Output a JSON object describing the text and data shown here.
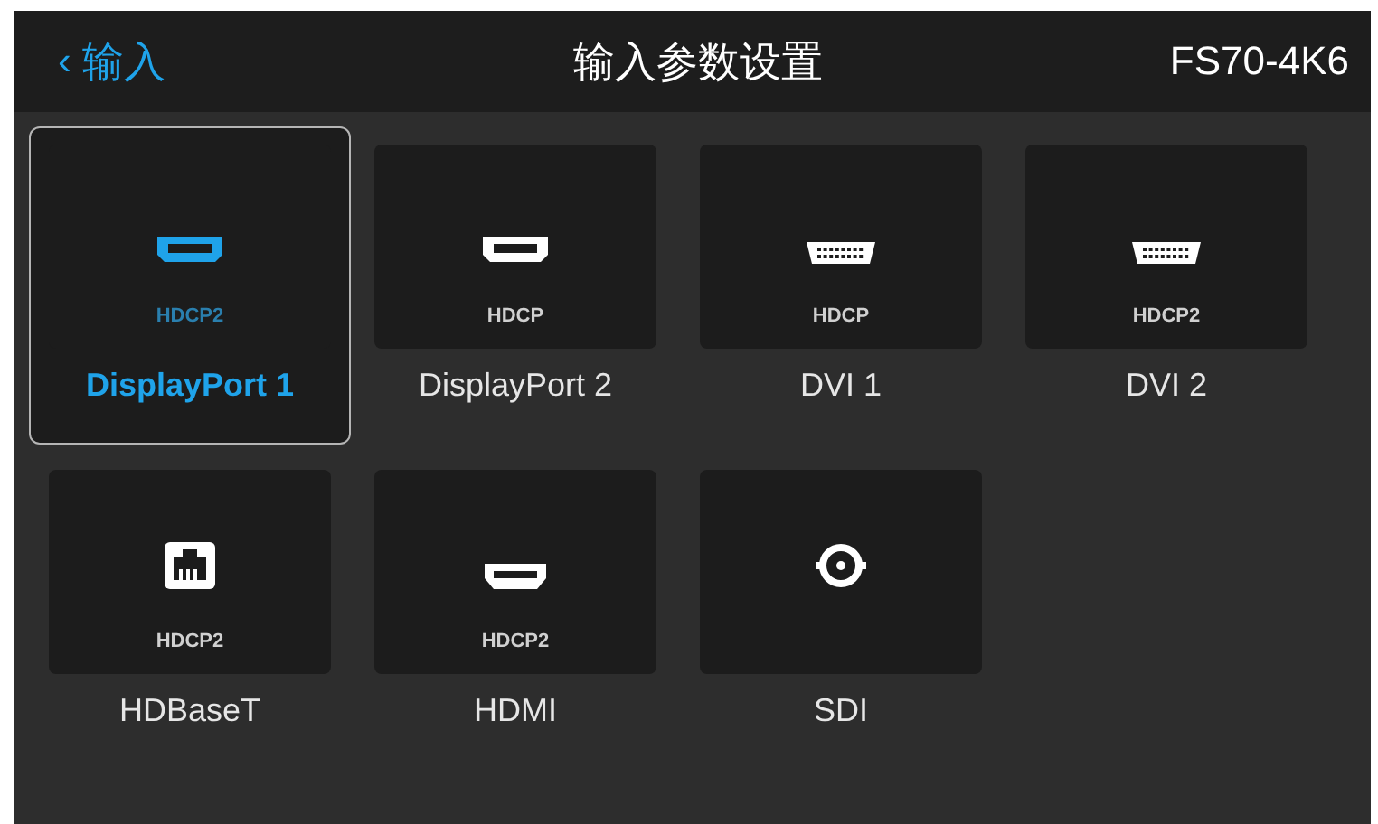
{
  "header": {
    "back": {
      "arrow": "‹",
      "label": "输入"
    },
    "title": "输入参数设置",
    "model": "FS70-4K6"
  },
  "inputs": [
    {
      "name": "DisplayPort 1",
      "hdcp": "HDCP2",
      "kind": "displayport",
      "selected": true
    },
    {
      "name": "DisplayPort 2",
      "hdcp": "HDCP",
      "kind": "displayport",
      "selected": false
    },
    {
      "name": "DVI 1",
      "hdcp": "HDCP",
      "kind": "dvi",
      "selected": false
    },
    {
      "name": "DVI 2",
      "hdcp": "HDCP2",
      "kind": "dvi",
      "selected": false
    },
    {
      "name": "HDBaseT",
      "hdcp": "HDCP2",
      "kind": "rj45",
      "selected": false
    },
    {
      "name": "HDMI",
      "hdcp": "HDCP2",
      "kind": "hdmi",
      "selected": false
    },
    {
      "name": "SDI",
      "kind": "bnc",
      "selected": false
    }
  ]
}
